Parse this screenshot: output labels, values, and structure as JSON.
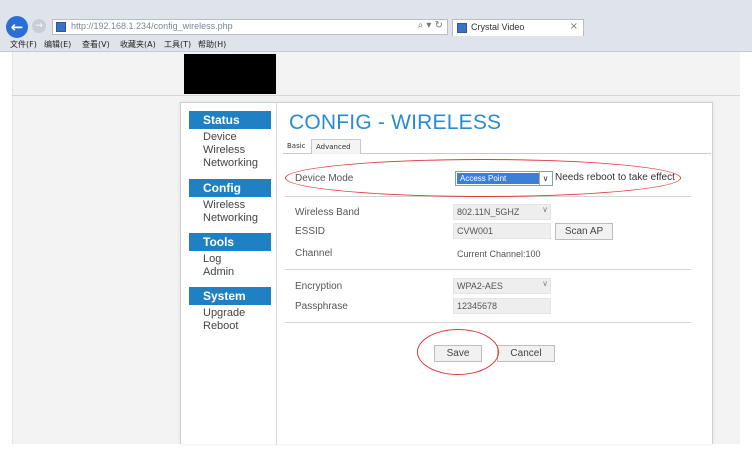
{
  "browser": {
    "address_url": "http://192.168.1.234/config_wireless.php",
    "tab_title": "Crystal Video",
    "back_glyph": "←",
    "forward_glyph": "→",
    "addr_icons": "⌕ ▾ ↻",
    "tab_close": "×",
    "menu": [
      "文件(F)",
      "编辑(E)",
      "查看(V)",
      "收藏夹(A)",
      "工具(T)",
      "帮助(H)"
    ]
  },
  "sidebar": {
    "status": {
      "heading": "Status",
      "items": [
        "Device",
        "Wireless",
        "Networking"
      ]
    },
    "config": {
      "heading": "Config",
      "items": [
        "Wireless",
        "Networking"
      ]
    },
    "tools": {
      "heading": "Tools",
      "items": [
        "Log",
        "Admin"
      ]
    },
    "system": {
      "heading": "System",
      "items": [
        "Upgrade",
        "Reboot"
      ]
    }
  },
  "main": {
    "title": "CONFIG - WIRELESS",
    "tabs": [
      "Basic",
      "Advanced"
    ],
    "device_mode": {
      "label": "Device Mode",
      "value": "Access Point",
      "hint": "Needs reboot to take effect"
    },
    "wireless_band": {
      "label": "Wireless Band",
      "value": "802.11N_5GHZ"
    },
    "essid": {
      "label": "ESSID",
      "value": "CVW001"
    },
    "scan_ap_label": "Scan AP",
    "channel": {
      "label": "Channel",
      "value": "Current Channel:100"
    },
    "encryption": {
      "label": "Encryption",
      "value": "WPA2-AES"
    },
    "passphrase": {
      "label": "Passphrase",
      "value": "12345678"
    },
    "save_label": "Save",
    "cancel_label": "Cancel",
    "dropdown_glyph": "∨"
  },
  "colors": {
    "accent": "#2080c4",
    "title": "#2a8bd0",
    "highlight": "#e0393b",
    "selected": "#3d7fd6"
  }
}
